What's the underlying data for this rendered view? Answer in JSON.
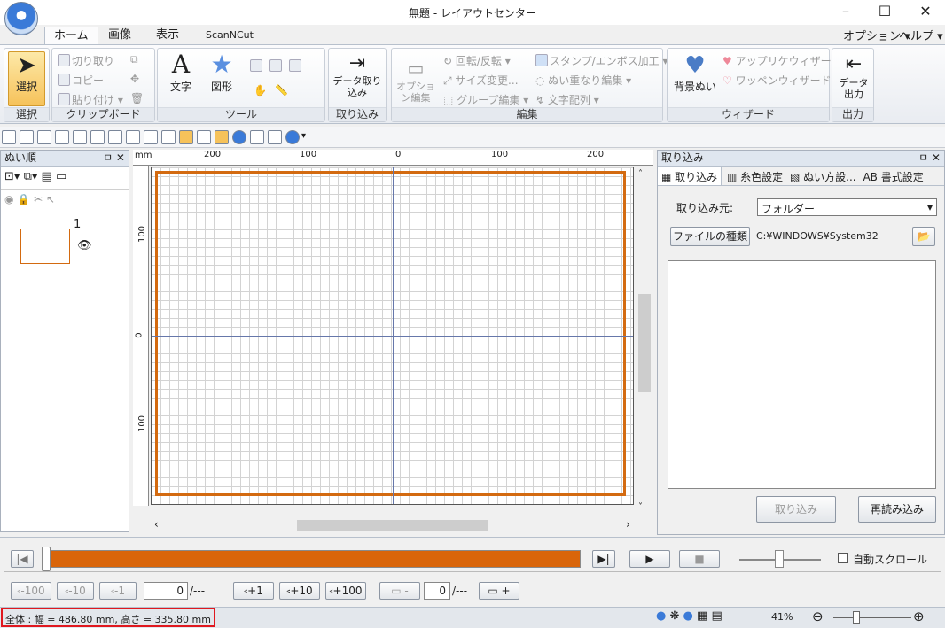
{
  "window": {
    "title": "無題 - レイアウトセンター",
    "minimize": "–",
    "maximize": "☐",
    "close": "✕"
  },
  "tabs": [
    "ホーム",
    "画像",
    "表示",
    "ScanNCut"
  ],
  "menu_right": {
    "options": "オプション",
    "help": "ヘルプ"
  },
  "ribbon": {
    "select": {
      "label": "選択",
      "group": "選択"
    },
    "clipboard": {
      "cut": "切り取り",
      "copy": "コピー",
      "paste": "貼り付け",
      "group": "クリップボード"
    },
    "tools": {
      "text": "文字",
      "shape": "図形",
      "group": "ツール"
    },
    "import": {
      "label": "データ取り込み",
      "group": "取り込み"
    },
    "edit": {
      "option": "オプション編集",
      "rotate": "回転/反転",
      "size": "サイズ変更...",
      "group_edit": "グループ編集",
      "stamp": "スタンプ/エンボス加工",
      "overlap": "ぬい重なり編集",
      "text_array": "文字配列",
      "group": "編集"
    },
    "wizard": {
      "bg": "背景ぬい",
      "applique": "アップリケウィザード",
      "patch": "ワッペンウィザード",
      "group": "ウィザード"
    },
    "output": {
      "label": "データ出力",
      "group": "出力"
    }
  },
  "left_panel": {
    "title": "ぬい順",
    "item_number": "1"
  },
  "ruler": {
    "unit": "mm",
    "top_labels": [
      "200",
      "100",
      "0",
      "100",
      "200"
    ],
    "left_labels": [
      "100",
      "0",
      "100"
    ]
  },
  "right_panel": {
    "title": "取り込み",
    "tabs": [
      "取り込み",
      "糸色設定",
      "ぬい方設...",
      "AB 書式設定"
    ],
    "source_label": "取り込み元:",
    "source_value": "フォルダー",
    "filetype_button": "ファイルの種類",
    "path": "C:¥WINDOWS¥System32",
    "import_button": "取り込み",
    "reload_button": "再読み込み"
  },
  "playback": {
    "autoscroll": "自動スクロール"
  },
  "stepper": {
    "m100": "-100",
    "m10": "-10",
    "m1": "-1",
    "value": "0",
    "slash": "/---",
    "p1": "+1",
    "p10": "+10",
    "p100": "+100",
    "minus": "-",
    "value2": "0",
    "slash2": "/---",
    "plus": "+"
  },
  "status": {
    "size": "全体 : 幅 = 486.80 mm, 高さ = 335.80 mm",
    "zoom": "41%"
  }
}
